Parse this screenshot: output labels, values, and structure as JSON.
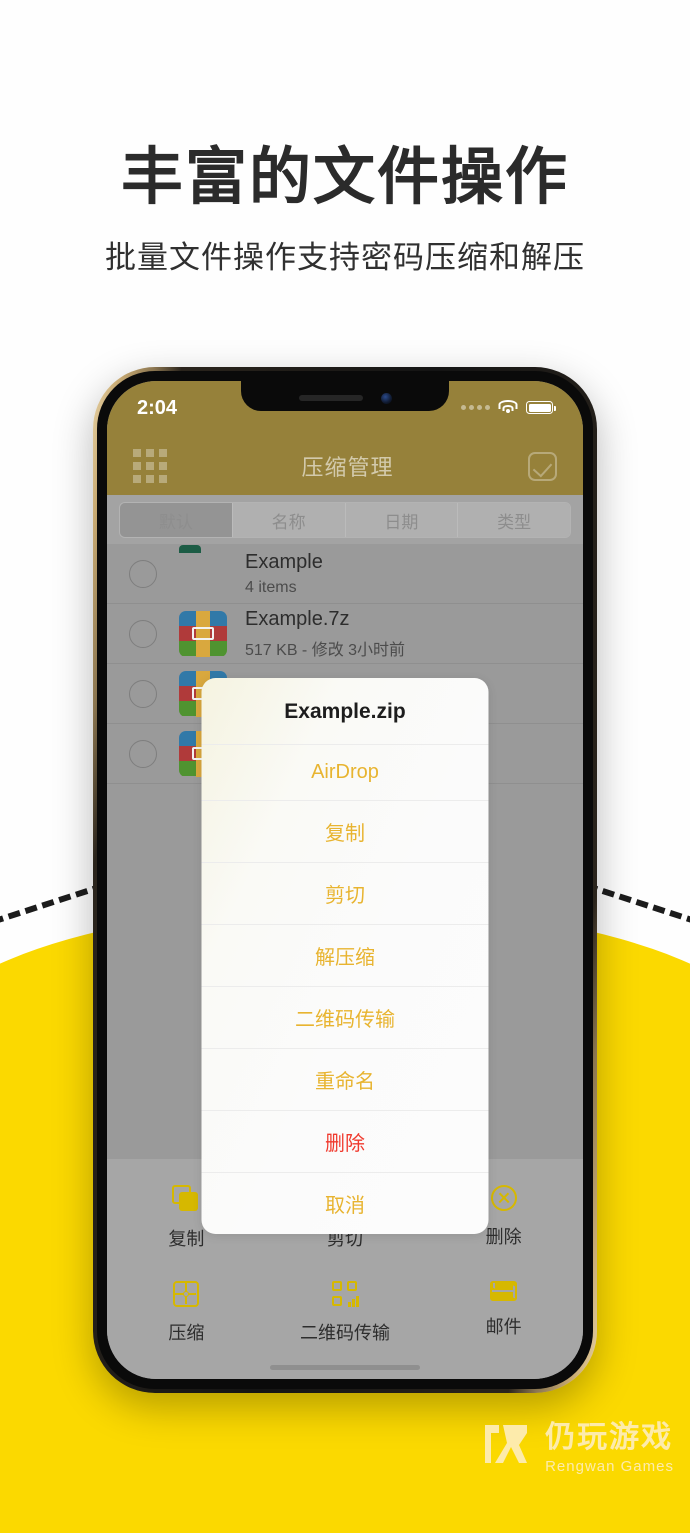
{
  "page": {
    "headline": "丰富的文件操作",
    "subhead": "批量文件操作支持密码压缩和解压",
    "accent_yellow": "#fbd900",
    "nav_olive": "#96813a",
    "screen_gray": "#9a9a9a"
  },
  "status_bar": {
    "time": "2:04",
    "wifi_icon": "wifi-icon",
    "battery_icon": "battery-icon",
    "signal_icon": "signal-dots-icon"
  },
  "nav_bar": {
    "left_icon": "grid-icon",
    "title": "压缩管理",
    "right_icon": "checkbox-icon"
  },
  "segmented": {
    "options": [
      "默认",
      "名称",
      "日期",
      "类型"
    ],
    "selected": "默认"
  },
  "files": [
    {
      "name": "Example",
      "meta": "4  items",
      "icon": "folder-icon"
    },
    {
      "name": "Example.7z",
      "meta": "517 KB - 修改 3小时前",
      "icon": "archive-icon"
    },
    {
      "name": "",
      "meta": "",
      "icon": "archive-icon"
    },
    {
      "name": "",
      "meta": "",
      "icon": "archive-icon"
    }
  ],
  "action_sheet": {
    "title": "Example.zip",
    "items": [
      {
        "label": "AirDrop",
        "style": "normal"
      },
      {
        "label": "复制",
        "style": "normal"
      },
      {
        "label": "剪切",
        "style": "normal"
      },
      {
        "label": "解压缩",
        "style": "normal"
      },
      {
        "label": "二维码传输",
        "style": "normal"
      },
      {
        "label": "重命名",
        "style": "normal"
      },
      {
        "label": "删除",
        "style": "destructive"
      },
      {
        "label": "取消",
        "style": "normal"
      }
    ]
  },
  "toolbar": {
    "row1": [
      {
        "label": "复制",
        "icon": "copy-icon"
      },
      {
        "label": "剪切",
        "icon": "crop-icon"
      },
      {
        "label": "删除",
        "icon": "delete-circle-icon"
      }
    ],
    "row2": [
      {
        "label": "压缩",
        "icon": "compress-icon"
      },
      {
        "label": "二维码传输",
        "icon": "qrcode-icon"
      },
      {
        "label": "邮件",
        "icon": "mail-icon"
      }
    ]
  },
  "watermark": {
    "logo": "rengwan-logo-icon",
    "cn": "仍玩游戏",
    "en": "Rengwan Games"
  }
}
